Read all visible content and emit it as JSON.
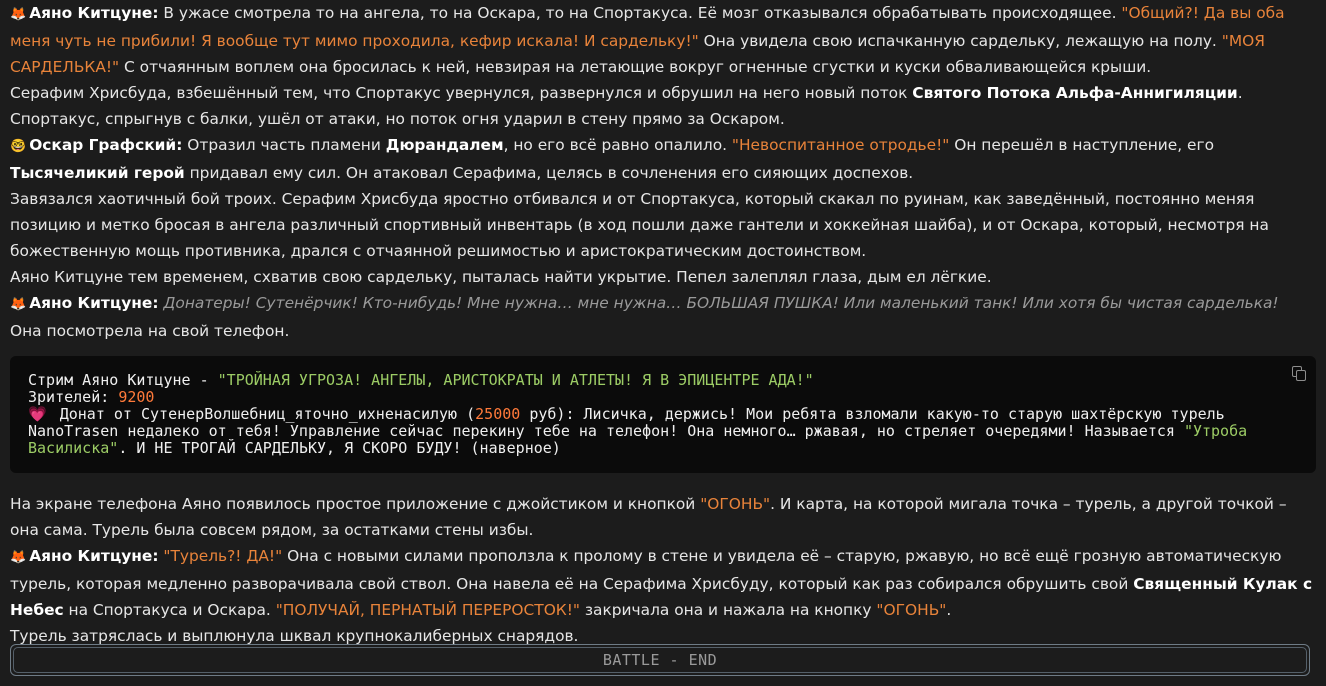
{
  "msgs": {
    "p1": {
      "icon": "fox-emoji-icon",
      "speaker": "Аяно Китцуне:",
      "t1": " В ужасе смотрела то на ангела, то на Оскара, то на Спортакуса. Её мозг отказывался обрабатывать происходящее. ",
      "q1": "\"Общий?! Да вы оба меня чуть не прибили! Я вообще тут мимо проходила, кефир искала! И сардельку!\"",
      "t2": " Она увидела свою испачканную сардельку, лежащую на полу. ",
      "q2": "\"МОЯ САРДЕЛЬКА!\"",
      "t3": " С отчаянным воплем она бросилась к ней, невзирая на летающие вокруг огненные сгустки и куски обваливающейся крыши."
    },
    "p2": {
      "t1": "Серафим Хрисбуда, взбешённый тем, что Спортакус увернулся, развернулся и обрушил на него новый поток ",
      "b1": "Святого Потока Альфа-Аннигиляции",
      "t2": ". Спортакус, спрыгнув с балки, ушёл от атаки, но поток огня ударил в стену прямо за Оскаром."
    },
    "p3": {
      "icon": "face-emoji-icon",
      "speaker": "Оскар Графский:",
      "t1": " Отразил часть пламени ",
      "b1": "Дюрандалем",
      "t2": ", но его всё равно опалило. ",
      "q1": "\"Невоспитанное отродье!\"",
      "t3": " Он перешёл в наступление, его ",
      "b2": "Тысячеликий герой",
      "t4": " придавал ему сил. Он атаковал Серафима, целясь в сочленения его сияющих доспехов."
    },
    "p4": "Завязался хаотичный бой троих. Серафим Хрисбуда яростно отбивался и от Спортакуса, который скакал по руинам, как заведённый, постоянно меняя позицию и метко бросая в ангела различный спортивный инвентарь (в ход пошли даже гантели и хоккейная шайба), и от Оскара, который, несмотря на божественную мощь противника, дрался с отчаянной решимостью и аристократическим достоинством.",
    "p5": "Аяно Китцуне тем временем, схватив свою сардельку, пыталась найти укрытие. Пепел залеплял глаза, дым ел лёгкие.",
    "p6": {
      "icon": "fox-emoji-icon",
      "speaker": "Аяно Китцуне:",
      "italic": " Донатеры! Сутенёрчик! Кто-нибудь! Мне нужна… мне нужна… БОЛЬШАЯ ПУШКА! Или маленький танк! Или хотя бы чистая сарделька!"
    },
    "p7": "Она посмотрела на свой телефон."
  },
  "code": {
    "l1a": "Стрим Аяно Китцуне - ",
    "l1q": "\"ТРОЙНАЯ УГРОЗА! АНГЕЛЫ, АРИСТОКРАТЫ И АТЛЕТЫ! Я В ЭПИЦЕНТРЕ АДА!\"",
    "l2a": "Зрителей: ",
    "l2n": "9200",
    "heart": "💗",
    "l3a": " Донат от СутенерВолшебниц_яточно_ихненасилую (",
    "l3n": "25000",
    "l3b": " руб): Лисичка, держись! Мои ребята взломали какую-то старую шахтёрскую турель NanoTrasen недалеко от тебя! Управление сейчас перекину тебе на телефон! Она немного… ржавая, но стреляет очередями! Называется ",
    "l3q": "\"Утроба Василиска\"",
    "l3c": ". И НЕ ТРОГАЙ САРДЕЛЬКУ, Я СКОРО БУДУ! (наверное)"
  },
  "after": {
    "p1": {
      "t1": "На экране телефона Аяно появилось простое приложение с джойстиком и кнопкой ",
      "q1": "\"ОГОНЬ\"",
      "t2": ". И карта, на которой мигала точка – турель, а другой точкой – она сама. Турель была совсем рядом, за остатками стены избы."
    },
    "p2": {
      "icon": "fox-emoji-icon",
      "speaker": "Аяно Китцуне:",
      "q1": " \"Турель?! ДА!\"",
      "t1": " Она с новыми силами проползла к пролому в стене и увидела её – старую, ржавую, но всё ещё грозную автоматическую турель, которая медленно разворачивала свой ствол. Она навела её на Серафима Хрисбуду, который как раз собирался обрушить свой ",
      "b1": "Священный Кулак с Небес",
      "t2": " на Спортакуса и Оскара. ",
      "q2": "\"ПОЛУЧАЙ, ПЕРНАТЫЙ ПЕРЕРОСТОК!\"",
      "t3": " закричала она и нажала на кнопку ",
      "q3": "\"ОГОНЬ\"",
      "t4": "."
    },
    "p3": "Турель затряслась и выплюнула шквал крупнокалиберных снарядов."
  },
  "battle_button": "BATTLE - END",
  "colors": {
    "orange": "#e8833a",
    "green": "#9ccc65",
    "number": "#ff7a3a",
    "bg": "#1c1c1c"
  }
}
